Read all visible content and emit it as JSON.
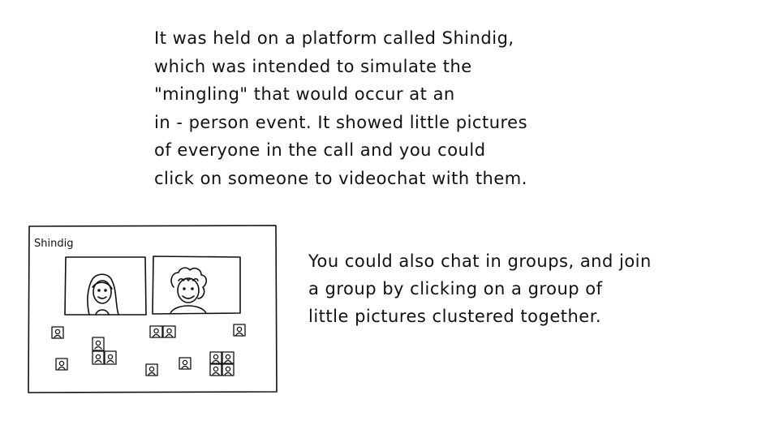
{
  "paragraph_1": [
    "It  was  held  on  a  platform  called  Shindig,",
    "which  was  intended  to  simulate  the",
    "\"mingling\"  that  would  occur  at  an",
    "in - person  event.  It  showed  little  pictures",
    "of  everyone  in  the  call  and  you  could",
    "click  on  someone  to  videochat  with  them."
  ],
  "paragraph_2": [
    "You  could  also  chat  in  groups,  and  join",
    "a  group  by  clicking  on  a  group  of",
    "little  pictures  clustered  together."
  ],
  "sketch": {
    "app_title": "Shindig",
    "ink_color": "#111111"
  }
}
